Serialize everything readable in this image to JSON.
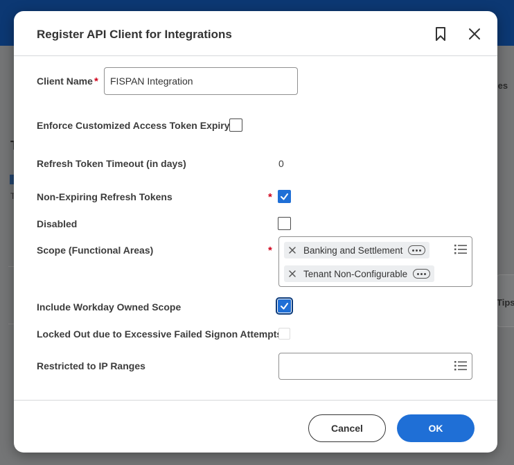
{
  "background": {
    "fragment_right_top": "ories",
    "fragment_left_t": "T",
    "fragment_left_t2": "T",
    "fragment_tips": "Tips"
  },
  "dialog": {
    "title": "Register API Client for Integrations",
    "header_icons": [
      "bookmark-icon",
      "close-icon"
    ],
    "fields": {
      "client_name": {
        "label": "Client Name",
        "required": "*",
        "value": "FISPAN Integration"
      },
      "enforce_expiry": {
        "label": "Enforce Customized Access Token Expiry",
        "checked": false
      },
      "refresh_timeout": {
        "label": "Refresh Token Timeout (in days)",
        "value": "0"
      },
      "non_expiring": {
        "label": "Non-Expiring Refresh Tokens",
        "required": "*",
        "checked": true
      },
      "disabled": {
        "label": "Disabled",
        "checked": false
      },
      "scope": {
        "label": "Scope (Functional Areas)",
        "required": "*",
        "items": [
          "Banking and Settlement",
          "Tenant Non-Configurable"
        ]
      },
      "include_owned": {
        "label": "Include Workday Owned Scope",
        "checked": true
      },
      "locked_out": {
        "label": "Locked Out due to Excessive Failed Signon Attempts",
        "checked": false
      },
      "ip_ranges": {
        "label": "Restricted to IP Ranges",
        "value": ""
      }
    },
    "buttons": {
      "cancel": "Cancel",
      "ok": "OK"
    },
    "colors": {
      "primary": "#1f6fd6",
      "required": "#d0021b",
      "header_bar": "#0c3873"
    }
  }
}
